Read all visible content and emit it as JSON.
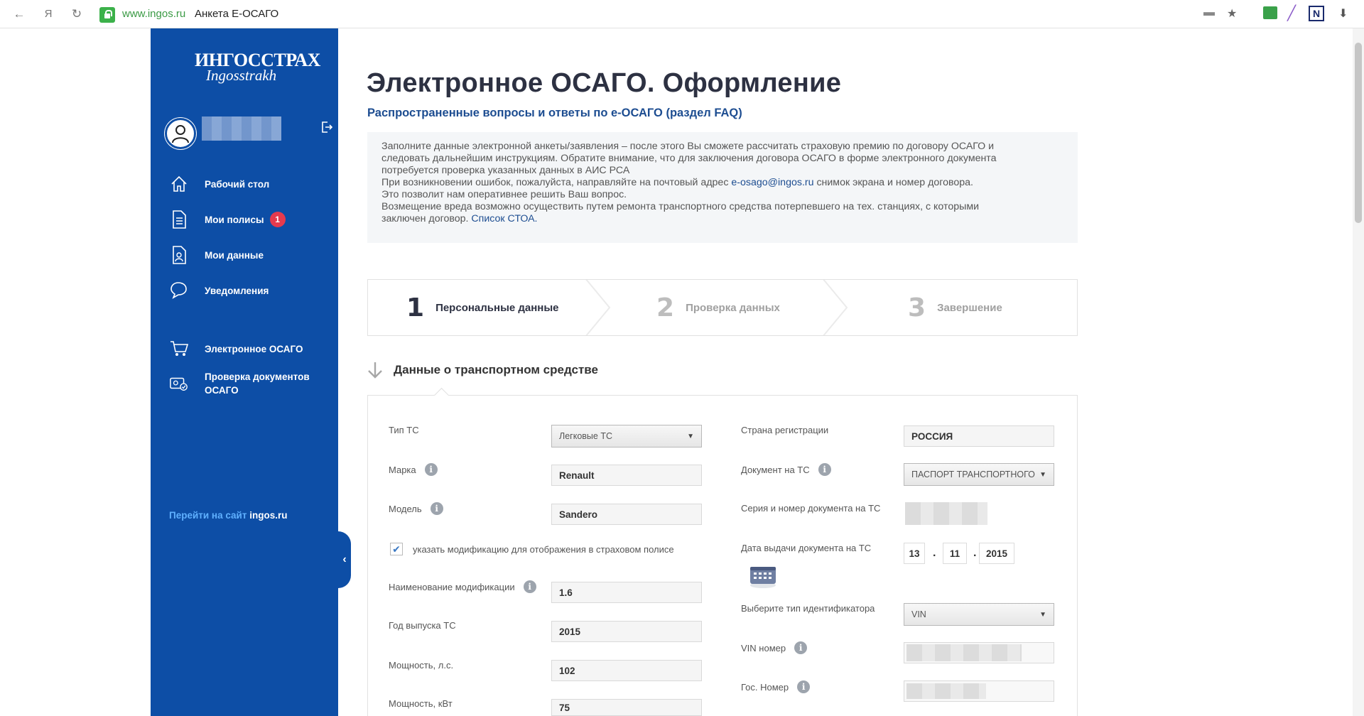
{
  "browser": {
    "domain": "www.ingos.ru",
    "tab_title": "Анкета Е-ОСАГО",
    "back_icon": "arrow-left-icon",
    "yandex_label": "Я",
    "reload_icon": "reload-icon"
  },
  "sidebar": {
    "logo_ru": "ИНГОССТРАХ",
    "logo_en": "Ingosstrakh",
    "items": [
      {
        "label": "Рабочий стол",
        "icon": "home-icon"
      },
      {
        "label": "Мои полисы",
        "icon": "document-icon",
        "badge": "1"
      },
      {
        "label": "Мои данные",
        "icon": "user-document-icon"
      },
      {
        "label": "Уведомления",
        "icon": "chat-icon"
      },
      {
        "label": "Электронное ОСАГО",
        "icon": "cart-icon"
      },
      {
        "label": "Проверка документов ОСАГО",
        "label_line1": "Проверка документов",
        "label_line2": "ОСАГО",
        "icon": "check-documents-icon"
      }
    ],
    "site_link_prefix": "Перейти на сайт",
    "site_link_domain": "ingos.ru"
  },
  "main": {
    "title": "Электронное ОСАГО. Оформление",
    "faq": "Распространенные вопросы и ответы по е-ОСАГО (раздел FAQ)",
    "info": {
      "line1": "Заполните данные электронной анкеты/заявления – после этого Вы сможете рассчитать страховую премию по договору ОСАГО и",
      "line2": "следовать дальнейшим инструкциям. Обратите внимание, что для заключения договора ОСАГО в форме электронного документа",
      "line3": "потребуется проверка указанных данных в АИС РСА",
      "line4_pre": "При возникновении ошибок, пожалуйста, направляйте на почтовый адрес ",
      "line4_email": "e-osago@ingos.ru",
      "line4_post": " снимок экрана и номер договора.",
      "line5": "Это позволит нам оперативнее решить Ваш вопрос.",
      "line6": "Возмещение вреда возможно осуществить путем ремонта транспортного средства потерпевшего на тех. станциях, с которыми",
      "line7_pre": "заключен договор. ",
      "line7_link": "Список СТОА."
    },
    "steps": [
      {
        "num": "1",
        "label": "Персональные данные",
        "active": true
      },
      {
        "num": "2",
        "label": "Проверка данных",
        "active": false
      },
      {
        "num": "3",
        "label": "Завершение",
        "active": false
      }
    ],
    "section_title": "Данные о транспортном средстве"
  },
  "form": {
    "vehicle_type": {
      "label": "Тип ТС",
      "value": "Легковые ТС"
    },
    "brand": {
      "label": "Марка",
      "value": "Renault"
    },
    "model": {
      "label": "Модель",
      "value": "Sandero"
    },
    "modification_checkbox": {
      "label": "указать модификацию для отображения в страховом полисе",
      "checked": true
    },
    "modification_name": {
      "label": "Наименование модификации",
      "value": "1.6"
    },
    "year": {
      "label": "Год выпуска ТС",
      "value": "2015"
    },
    "power_hp": {
      "label": "Мощность, л.с.",
      "value": "102"
    },
    "power_kw": {
      "label": "Мощность, кВт",
      "value": "75"
    },
    "country": {
      "label": "Страна регистрации",
      "value": "РОССИЯ"
    },
    "doc_type": {
      "label": "Документ на ТС",
      "value": "ПАСПОРТ ТРАНСПОРТНОГО"
    },
    "doc_number": {
      "label": "Серия и номер документа на ТС"
    },
    "doc_date": {
      "label": "Дата выдачи документа на ТС",
      "day": "13",
      "month": "11",
      "year": "2015"
    },
    "id_type": {
      "label": "Выберите тип идентификатора",
      "value": "VIN"
    },
    "vin": {
      "label": "VIN номер"
    },
    "plate": {
      "label": "Гос. Номер"
    }
  },
  "colors": {
    "sidebar": "#0d4ea6",
    "badge": "#e53a4e",
    "link": "#1d4d91",
    "title": "#2d3142"
  }
}
